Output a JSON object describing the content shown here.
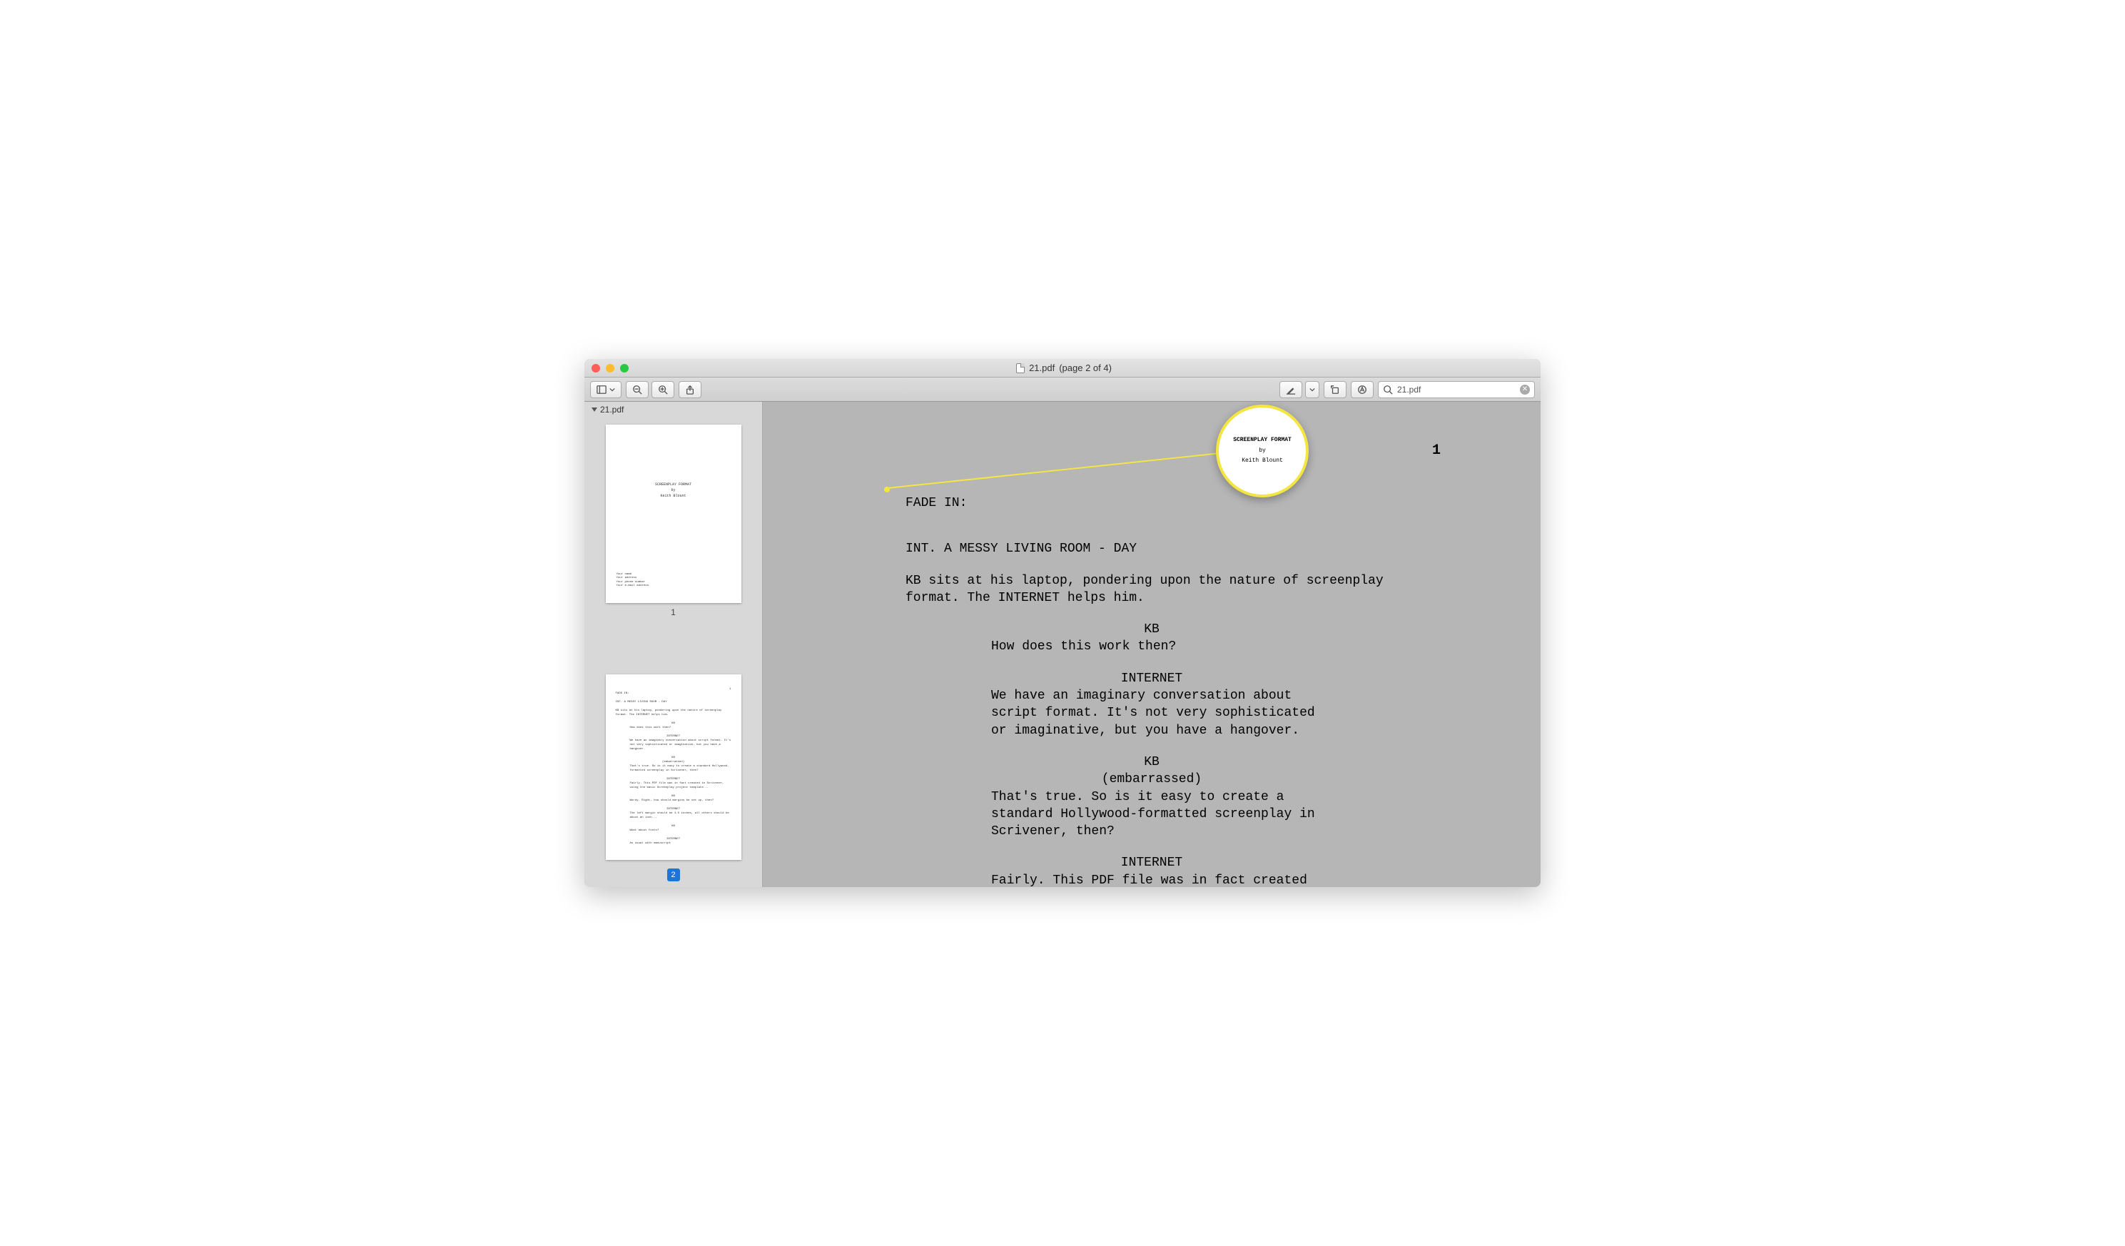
{
  "window": {
    "title_filename": "21.pdf",
    "title_pageinfo": "(page 2 of 4)"
  },
  "toolbar": {
    "search_value": "21.pdf"
  },
  "sidebar": {
    "doc_name": "21.pdf",
    "thumb1": {
      "title": "SCREENPLAY FORMAT",
      "by": "by",
      "author": "Keith Blount",
      "addr1": "Your name",
      "addr2": "Your address",
      "addr3": "Your phone number",
      "addr4": "Your e-mail address",
      "pagenum": "1"
    },
    "thumb2": {
      "pagenum": "2"
    }
  },
  "magnifier": {
    "line1": "SCREENPLAY FORMAT",
    "line2": "by",
    "line3": "Keith Blount"
  },
  "document": {
    "page_number": "1",
    "fade_in": "FADE IN:",
    "scene_heading": "INT. A MESSY LIVING ROOM - DAY",
    "action1": "KB sits at his laptop, pondering upon the nature of screenplay format. The INTERNET helps him.",
    "char1": "KB",
    "dlg1": "How does this work then?",
    "char2": "INTERNET",
    "dlg2": "We have an imaginary conversation about script format. It's not very sophisticated or imaginative, but you have a hangover.",
    "char3": "KB",
    "paren3": "(embarrassed)",
    "dlg3": "That's true. So is it easy to create a standard Hollywood-formatted screenplay in Scrivener, then?",
    "char4": "INTERNET",
    "dlg4": "Fairly. This PDF file was in fact created in Scrivener, using the"
  }
}
